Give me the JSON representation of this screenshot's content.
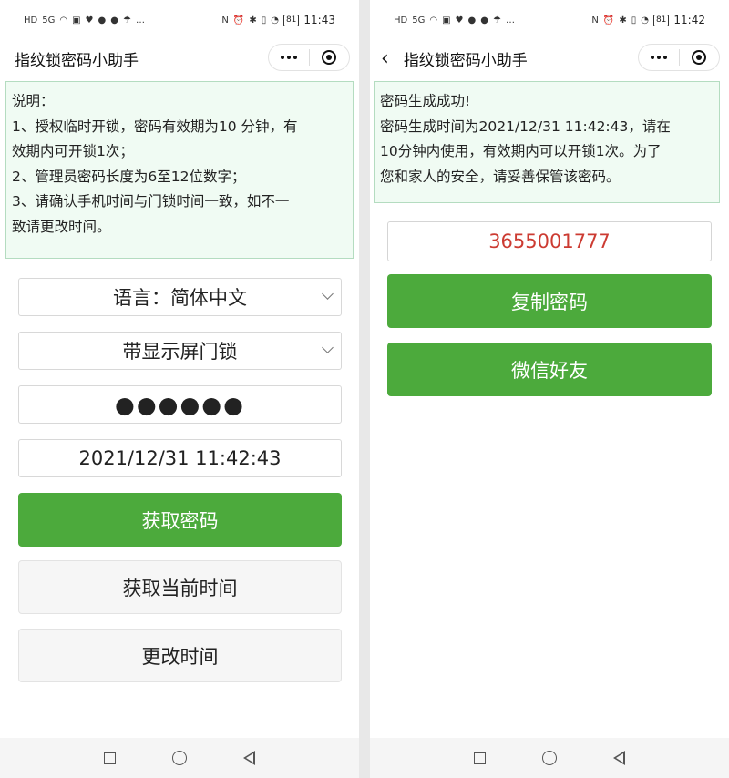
{
  "status_bar": {
    "left_icons": [
      "HD",
      "5G",
      "signal",
      "wifi",
      "app",
      "heart",
      "globe",
      "chat",
      "umbrella",
      "…"
    ],
    "right_icons": [
      "N",
      "alarm",
      "bluetooth",
      "vibrate",
      "speedometer"
    ],
    "battery": "81"
  },
  "left": {
    "status_time": "11:43",
    "title": "指纹锁密码小助手",
    "info_lines": [
      "说明：",
      "1、授权临时开锁，密码有效期为10 分钟，有",
      "效期内可开锁1次；",
      "2、管理员密码长度为6至12位数字；",
      "3、请确认手机时间与门锁时间一致，如不一",
      "致请更改时间。"
    ],
    "language_select": "语言：简体中文",
    "lock_type_select": "带显示屏门锁",
    "password_value": "●●●●●●",
    "datetime_value": "2021/12/31 11:42:43",
    "get_password_label": "获取密码",
    "get_time_label": "获取当前时间",
    "change_time_label": "更改时间"
  },
  "right": {
    "status_time": "11:42",
    "title": "指纹锁密码小助手",
    "info_lines": [
      "密码生成成功!",
      "密码生成时间为2021/12/31 11:42:43，请在",
      "10分钟内使用，有效期内可以开锁1次。为了",
      "您和家人的安全，请妥善保管该密码。"
    ],
    "generated_password": "3655001777",
    "copy_label": "复制密码",
    "wechat_label": "微信好友"
  },
  "colors": {
    "green": "#4caa3c",
    "info_bg": "#f0fbf3",
    "info_border": "#b4dcc0",
    "password_red": "#cc3b32"
  }
}
